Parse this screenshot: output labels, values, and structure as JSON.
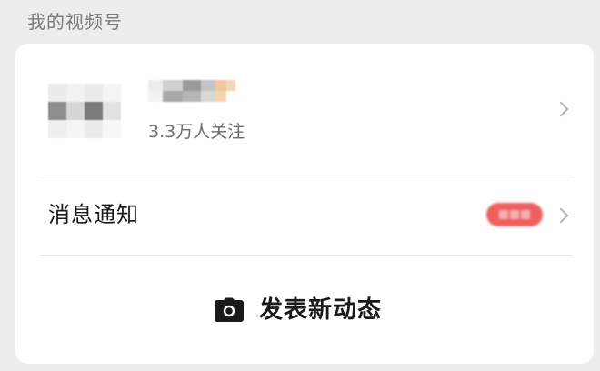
{
  "section": {
    "title": "我的视频号"
  },
  "profile": {
    "followers": "3.3万人关注"
  },
  "notify": {
    "label": "消息通知"
  },
  "post": {
    "label": "发表新动态"
  },
  "colors": {
    "page_background": "#ededed",
    "card_background": "#ffffff",
    "badge_red": "#ee6060",
    "chevron_gray": "#b2b2b2",
    "secondary_text": "#6e6e6e"
  },
  "icons": {
    "chevron": "chevron-right-icon",
    "camera": "camera-icon"
  }
}
